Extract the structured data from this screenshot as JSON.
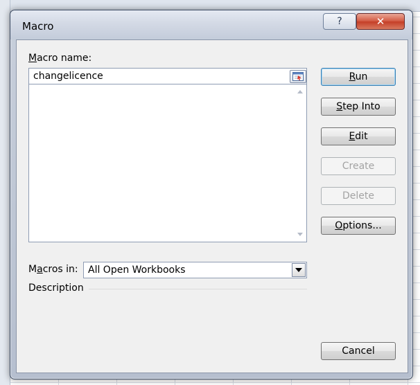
{
  "dialog": {
    "title": "Macro",
    "help_label": "?",
    "close_label": "✕"
  },
  "macro_name": {
    "label_access_key": "M",
    "label_rest": "acro name:",
    "value": "changelicence"
  },
  "macro_list": {
    "items": []
  },
  "buttons": {
    "run": {
      "key": "R",
      "rest": "un",
      "enabled": true
    },
    "step_into": {
      "key": "S",
      "rest": "tep Into",
      "enabled": true
    },
    "edit": {
      "key": "E",
      "rest": "dit",
      "enabled": true
    },
    "create": {
      "label": "Create",
      "enabled": false
    },
    "delete": {
      "label": "Delete",
      "enabled": false
    },
    "options": {
      "key": "O",
      "rest": "ptions...",
      "enabled": true
    },
    "cancel": {
      "label": "Cancel",
      "enabled": true
    }
  },
  "macros_in": {
    "label_prefix": "M",
    "label_key": "a",
    "label_suffix": "cros in:",
    "selected": "All Open Workbooks"
  },
  "description": {
    "label": "Description",
    "text": ""
  },
  "icons": {
    "help": "help-icon",
    "close": "close-icon",
    "picker": "collapse-dialog-icon",
    "scroll_up": "scroll-up-icon",
    "scroll_down": "scroll-down-icon",
    "dropdown": "chevron-down-icon"
  }
}
